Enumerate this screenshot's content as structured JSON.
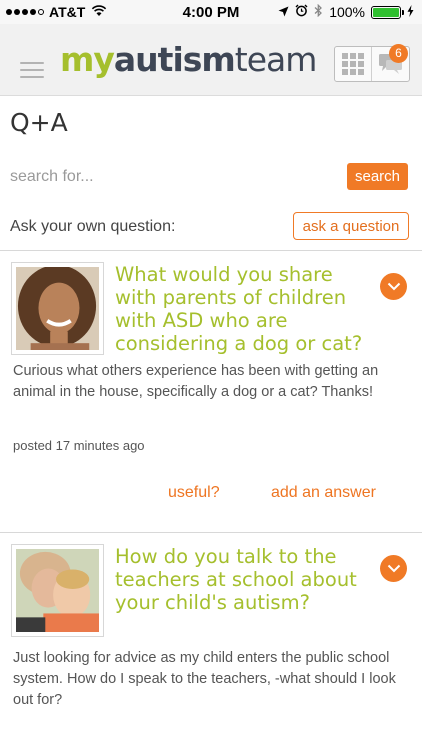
{
  "status_bar": {
    "carrier": "AT&T",
    "time": "4:00 PM",
    "battery": "100%",
    "battery_level": 1.0
  },
  "header": {
    "logo": {
      "part1": "my",
      "part2": "autism",
      "part3": "team"
    },
    "notification_count": "6"
  },
  "page": {
    "title": "Q+A",
    "search": {
      "placeholder": "search for...",
      "button_label": "search"
    },
    "ask": {
      "label": "Ask your own question:",
      "button_label": "ask a question"
    }
  },
  "questions": [
    {
      "title": "What would you share with parents of children with ASD who are considering a dog or cat?",
      "body": "Curious what others experience has been with getting an animal in the house, specifically a dog or a cat? Thanks!",
      "posted": "posted 17 minutes ago",
      "useful_label": "useful?",
      "answer_label": "add an answer"
    },
    {
      "title": "How do you talk to the teachers at school about your child's autism?",
      "body": "Just looking for advice as my child enters the public school system. How do I speak to the teachers, -what should I look out for?"
    }
  ],
  "colors": {
    "accent_orange": "#f07a26",
    "brand_green": "#a5bf2d",
    "brand_navy": "#3e4655"
  }
}
